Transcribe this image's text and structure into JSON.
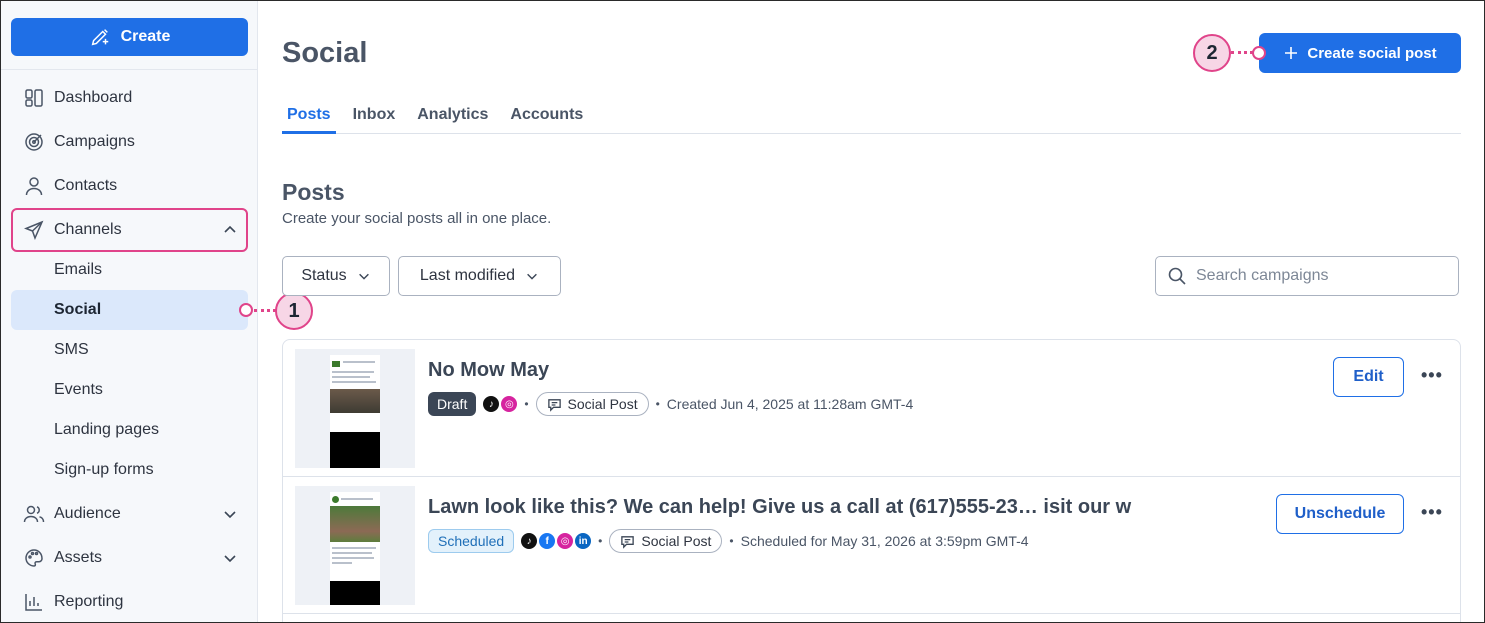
{
  "sidebar": {
    "create_label": "Create",
    "items": [
      {
        "label": "Dashboard",
        "icon": "dashboard-icon"
      },
      {
        "label": "Campaigns",
        "icon": "target-icon"
      },
      {
        "label": "Contacts",
        "icon": "person-icon"
      },
      {
        "label": "Channels",
        "icon": "paper-plane-icon"
      },
      {
        "label": "Audience",
        "icon": "people-icon"
      },
      {
        "label": "Assets",
        "icon": "palette-icon"
      },
      {
        "label": "Reporting",
        "icon": "chart-icon"
      }
    ],
    "channels_sub": [
      "Emails",
      "Social",
      "SMS",
      "Events",
      "Landing pages",
      "Sign-up forms"
    ]
  },
  "callouts": {
    "one": "1",
    "two": "2"
  },
  "header": {
    "title": "Social",
    "create_post_label": "Create social post"
  },
  "tabs": [
    "Posts",
    "Inbox",
    "Analytics",
    "Accounts"
  ],
  "section": {
    "title": "Posts",
    "subtitle": "Create your social posts all in one place."
  },
  "filters": {
    "status_label": "Status",
    "modified_label": "Last modified",
    "search_placeholder": "Search campaigns"
  },
  "posts": [
    {
      "title": "No Mow May",
      "status": "Draft",
      "type": "Social Post",
      "meta": "Created Jun 4, 2025 at 11:28am GMT-4",
      "action": "Edit",
      "networks": [
        "tiktok",
        "instagram"
      ]
    },
    {
      "title": "Lawn look like this? We can help! Give us a call at (617)555-23…  isit our w",
      "status": "Scheduled",
      "type": "Social Post",
      "meta": "Scheduled for May 31, 2026 at 3:59pm GMT-4",
      "action": "Unschedule",
      "networks": [
        "tiktok",
        "facebook",
        "instagram",
        "linkedin"
      ]
    }
  ],
  "colors": {
    "accent": "#1f6fe6",
    "callout": "#e0448a",
    "draft_badge": "#3b4656",
    "scheduled_badge": "#e3f1fb"
  }
}
